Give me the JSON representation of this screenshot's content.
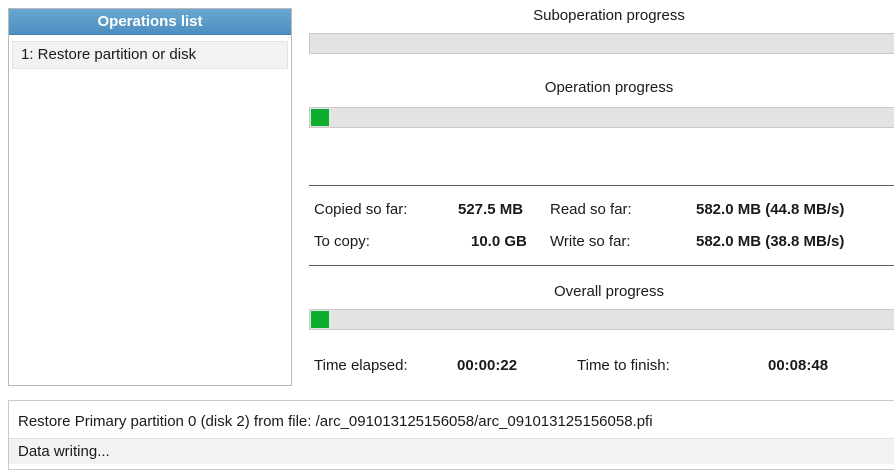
{
  "operations_list": {
    "header": "Operations list",
    "items": [
      {
        "label": "1: Restore partition or disk"
      }
    ]
  },
  "suboperation": {
    "title": "Suboperation progress",
    "progress": 0
  },
  "operation": {
    "title": "Operation progress",
    "progress": 0.03
  },
  "stats": {
    "copied_label": "Copied so far:",
    "copied_value": "527.5 MB",
    "read_label": "Read so far:",
    "read_value": "582.0 MB (44.8 MB/s)",
    "tocopy_label": "To copy:",
    "tocopy_value": "10.0 GB",
    "write_label": "Write so far:",
    "write_value": "582.0 MB (38.8 MB/s)"
  },
  "overall": {
    "title": "Overall progress",
    "progress": 0.03
  },
  "time": {
    "elapsed_label": "Time elapsed:",
    "elapsed_value": "00:00:22",
    "finish_label": "Time to finish:",
    "finish_value": "00:08:48"
  },
  "status": {
    "line1": "Restore Primary partition 0 (disk 2) from file: /arc_091013125156058/arc_091013125156058.pfi",
    "line2": "Data writing..."
  },
  "colors": {
    "progress_fill": "#0dae2e",
    "header_bg": "#4d8fc0"
  }
}
